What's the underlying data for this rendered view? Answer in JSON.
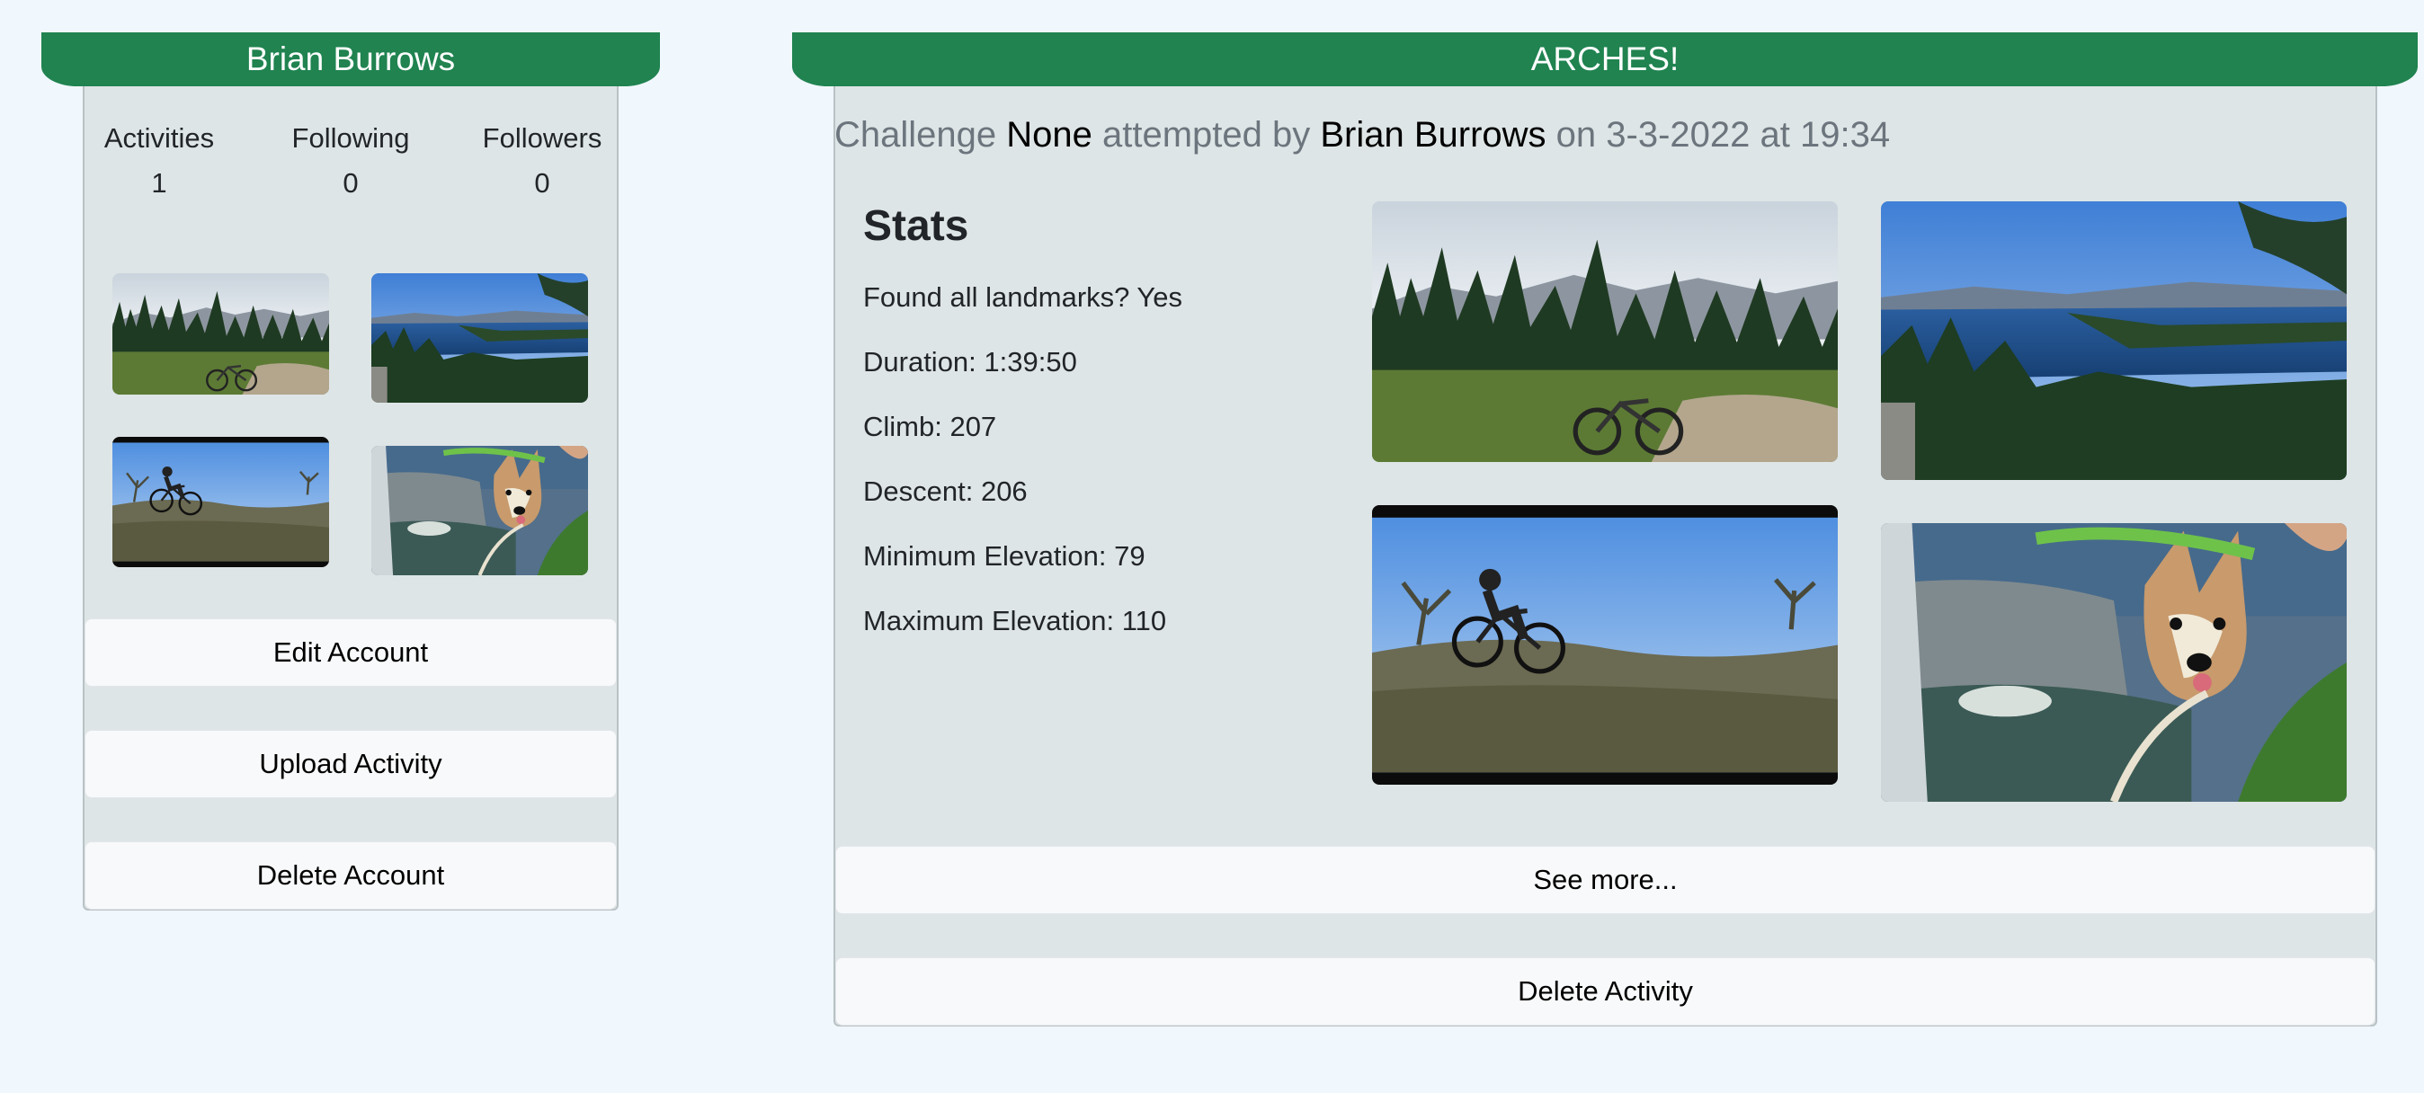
{
  "profile": {
    "name": "Brian Burrows",
    "counts": [
      {
        "label": "Activities",
        "value": "1"
      },
      {
        "label": "Following",
        "value": "0"
      },
      {
        "label": "Followers",
        "value": "0"
      }
    ],
    "buttons": {
      "edit": "Edit Account",
      "upload": "Upload Activity",
      "delete": "Delete Account"
    }
  },
  "activity": {
    "title": "ARCHES!",
    "line": {
      "pre": "Challenge ",
      "challenge": "None",
      "mid": " attempted by ",
      "user": "Brian Burrows",
      "post": " on 3-3-2022 at 19:34"
    },
    "stats_heading": "Stats",
    "stats": [
      "Found all landmarks? Yes",
      "Duration: 1:39:50",
      "Climb: 207",
      "Descent: 206",
      "Minimum Elevation: 79",
      "Maximum Elevation: 110"
    ],
    "buttons": {
      "see_more": "See more...",
      "delete": "Delete Activity"
    }
  },
  "colors": {
    "brand_green": "#208350",
    "page_bg": "#f0f7fd",
    "card_bg": "#dee5e6"
  }
}
